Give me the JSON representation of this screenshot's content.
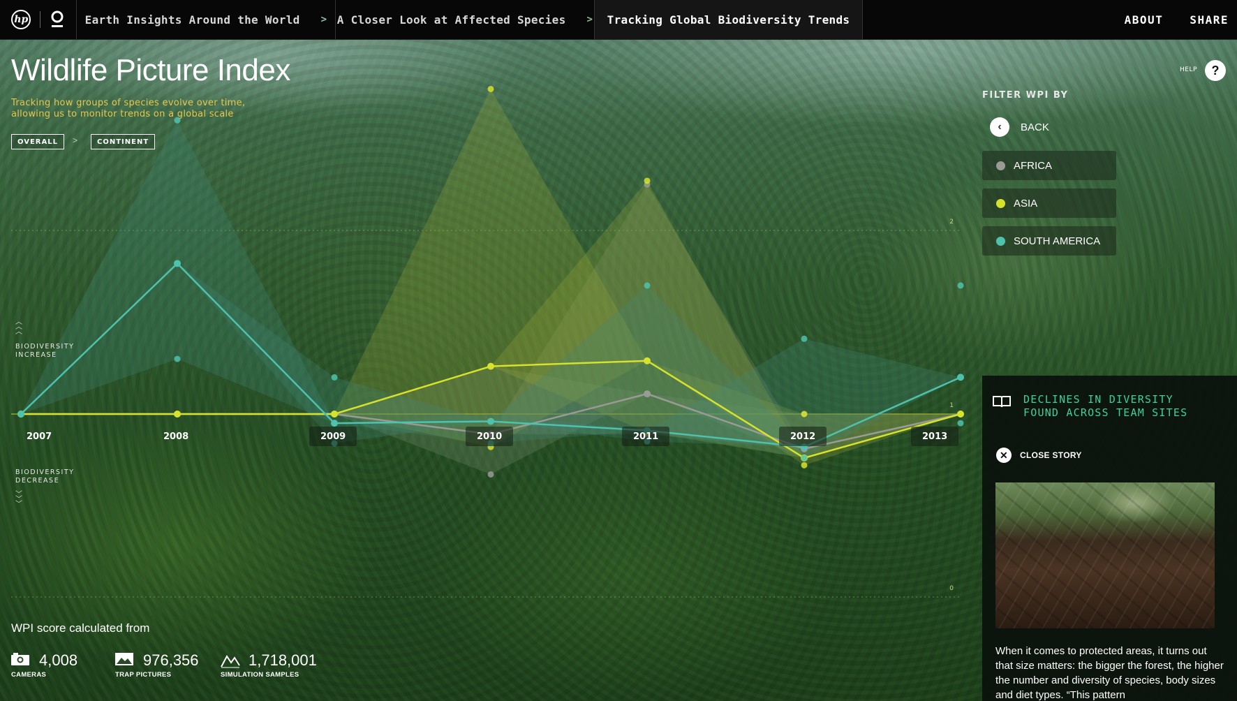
{
  "nav": {
    "tabs": [
      {
        "label": "Earth Insights Around the World",
        "chevron": ">"
      },
      {
        "label": "A Closer Look at Affected Species",
        "chevron": ">"
      },
      {
        "label": "Tracking Global Biodiversity Trends"
      }
    ],
    "about": "ABOUT",
    "share": "SHARE"
  },
  "header": {
    "title": "Wildlife Picture Index",
    "subtitle": "Tracking how groups of species evolve over time, allowing us to monitor trends on a global scale",
    "crumbs": {
      "overall": "OVERALL",
      "separator": ">",
      "continent": "CONTINENT"
    },
    "help_label": "HELP",
    "help_icon": "?"
  },
  "axis": {
    "increase_label": [
      "BIODIVERSITY",
      "INCREASE"
    ],
    "decrease_label": [
      "BIODIVERSITY",
      "DECREASE"
    ],
    "right_ticks": [
      "2",
      "1",
      "0"
    ]
  },
  "filter": {
    "title": "FILTER WPI BY",
    "back": "BACK",
    "items": [
      {
        "label": "AFRICA",
        "color": "#9a9a96"
      },
      {
        "label": "ASIA",
        "color": "#d6e22c"
      },
      {
        "label": "SOUTH AMERICA",
        "color": "#4fc2ad"
      }
    ]
  },
  "story": {
    "title": "DECLINES IN DIVERSITY FOUND ACROSS TEAM SITES",
    "close": "CLOSE STORY",
    "text": "When it comes to protected areas, it turns out that size matters: the bigger the forest, the higher the number and diversity of species, body sizes and diet types. “This pattern"
  },
  "stats": {
    "title": "WPI score calculated from",
    "items": [
      {
        "value": "4,008",
        "label": "CAMERAS",
        "icon": "camera-icon"
      },
      {
        "value": "976,356",
        "label": "TRAP PICTURES",
        "icon": "picture-icon"
      },
      {
        "value": "1,718,001",
        "label": "SIMULATION SAMPLES",
        "icon": "chart-line-icon"
      }
    ]
  },
  "chart_data": {
    "type": "line",
    "title": "Wildlife Picture Index",
    "categories": [
      "2007",
      "2008",
      "2009",
      "2010",
      "2011",
      "2012",
      "2013"
    ],
    "ylim": [
      0,
      2
    ],
    "baseline": 1,
    "series": [
      {
        "name": "AFRICA",
        "color": "#9a9a96",
        "values": [
          1.0,
          1.0,
          1.0,
          0.89,
          1.11,
          0.81,
          1.0
        ],
        "upper": [
          1.0,
          1.0,
          1.0,
          1.26,
          2.25,
          1.0,
          1.0
        ],
        "lower": [
          1.0,
          1.0,
          1.0,
          0.67,
          0.89,
          0.76,
          1.0
        ]
      },
      {
        "name": "ASIA",
        "color": "#d6e22c",
        "values": [
          1.0,
          1.0,
          1.0,
          1.26,
          1.29,
          0.76,
          1.0
        ],
        "upper": [
          1.0,
          1.0,
          1.0,
          2.77,
          2.27,
          1.0,
          1.0
        ],
        "lower": [
          1.0,
          1.0,
          1.0,
          0.82,
          0.9,
          0.72,
          1.0
        ]
      },
      {
        "name": "SOUTH AMERICA",
        "color": "#4fc2ad",
        "values": [
          1.0,
          1.82,
          0.95,
          0.96,
          0.91,
          0.82,
          1.2
        ],
        "upper": [
          1.0,
          2.6,
          1.2,
          1.0,
          1.7,
          1.41,
          1.7
        ],
        "lower": [
          1.0,
          1.3,
          0.84,
          0.84,
          0.85,
          0.76,
          0.95
        ]
      }
    ]
  }
}
